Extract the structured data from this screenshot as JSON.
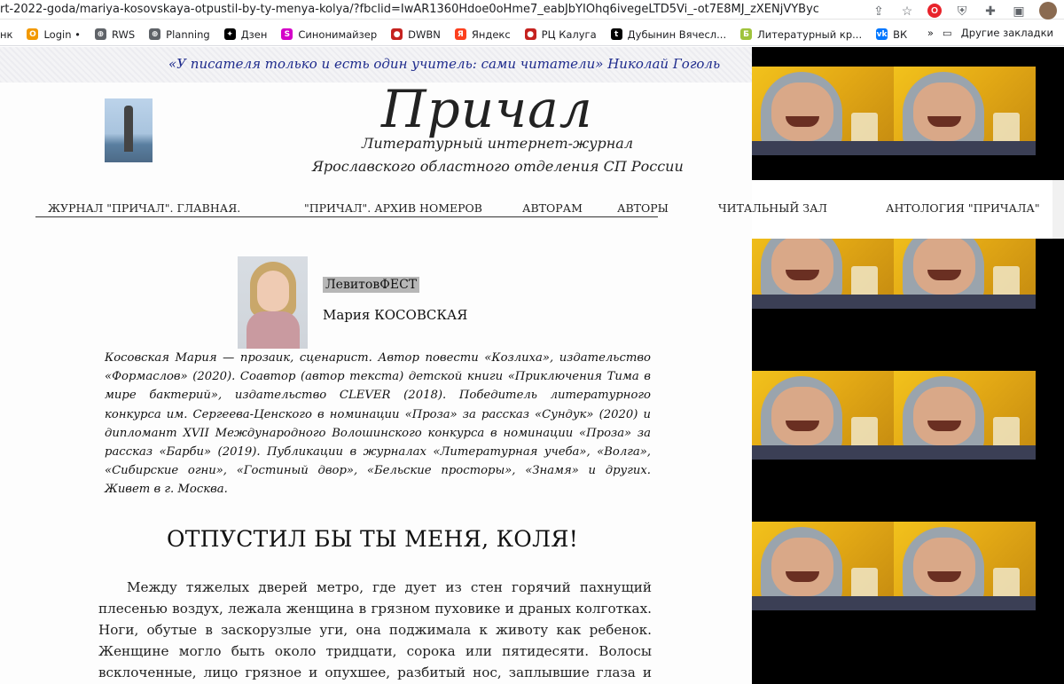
{
  "browser": {
    "url": "rt-2022-goda/mariya-kosovskaya-otpustil-by-ty-menya-kolya/?fbclid=IwAR1360Hdoe0oHme7_eabJbYIOhq6ivegeLTD5Vi_-ot7E8MJ_zXENjVYByc",
    "icons": [
      "share-icon",
      "star-icon",
      "opera-icon",
      "shield-icon",
      "puzzle-icon",
      "sidebar-icon",
      "avatar-icon"
    ],
    "bookmarks": [
      {
        "label": "нк",
        "color": "#ffffff",
        "icon": ""
      },
      {
        "label": "Login •",
        "color": "#f29900",
        "icon": "O"
      },
      {
        "label": "RWS",
        "color": "#5f6368",
        "icon": "⊕"
      },
      {
        "label": "Planning",
        "color": "#5f6368",
        "icon": "⊕"
      },
      {
        "label": "Дзен",
        "color": "#000000",
        "icon": "✦"
      },
      {
        "label": "Синонимайзер",
        "color": "#d400c8",
        "icon": "S"
      },
      {
        "label": "DWBN",
        "color": "#c5221f",
        "icon": "●"
      },
      {
        "label": "Яндекс",
        "color": "#fc3f1d",
        "icon": "Я"
      },
      {
        "label": "РЦ Калуга",
        "color": "#c5221f",
        "icon": "●"
      },
      {
        "label": "Дубынин Вячесл...",
        "color": "#000000",
        "icon": "t"
      },
      {
        "label": "Литературный кр...",
        "color": "#9fc33c",
        "icon": "Б"
      },
      {
        "label": "ВК",
        "color": "#0077ff",
        "icon": "vk"
      }
    ],
    "overflow_label": "»",
    "other_bookmarks_label": "Другие закладки"
  },
  "header": {
    "quote": "«У писателя только и есть один учитель: сами читатели»  Николай Гоголь",
    "title": "Причал",
    "subtitle_1": "Литературный интернет-журнал",
    "subtitle_2": "Ярославского областного отделения СП России"
  },
  "nav": {
    "items": [
      "ЖУРНАЛ \"ПРИЧАЛ\". ГЛАВНАЯ.",
      "\"ПРИЧАЛ\". АРХИВ НОМЕРОВ",
      "АВТОРАМ",
      "АВТОРЫ",
      "ЧИТАЛЬНЫЙ ЗАЛ",
      "АНТОЛОГИЯ \"ПРИЧАЛА\""
    ]
  },
  "article": {
    "tag": "ЛевитовФЕСТ",
    "author": "Мария КОСОВСКАЯ",
    "bio": "Косовская Мария — прозаик, сценарист. Автор повести «Козлиха», издательство «Формаслов» (2020). Соавтор (автор текста) детской книги «Приключения Тима в мире бактерий», издательство CLEVER (2018). Победитель литературного конкурса им. Сергеева-Ценского в номинации «Проза» за рассказ «Сундук» (2020) и дипломант XVII Международного Волошинского конкурса в номинации «Проза» за рассказ «Барби» (2019). Публикации в журналах «Литературная учеба», «Волга», «Сибирские огни», «Гостиный двор», «Бельские просторы», «Знамя» и других. Живет в г. Москва.",
    "story_title": "ОТПУСТИЛ БЫ ТЫ МЕНЯ, КОЛЯ!",
    "story_text": "Между тяжелых дверей метро, где дует из стен горячий пахнущий плесенью воздух, лежала женщина в грязном пуховике и драных колготках. Ноги, обутые в заскорузлые уги, она поджимала к животу как ребенок. Женщине могло быть около тридцати, сорока или пятидесяти. Волосы всклоченные, лицо грязное и опухшее, разбитый нос, заплывшие глаза и фиолетовая гематома на скуле. Черты"
  },
  "colors": {
    "quote": "#1d2a8c",
    "ad_background": "#000000",
    "tag_badge": "#b7b7b7"
  }
}
